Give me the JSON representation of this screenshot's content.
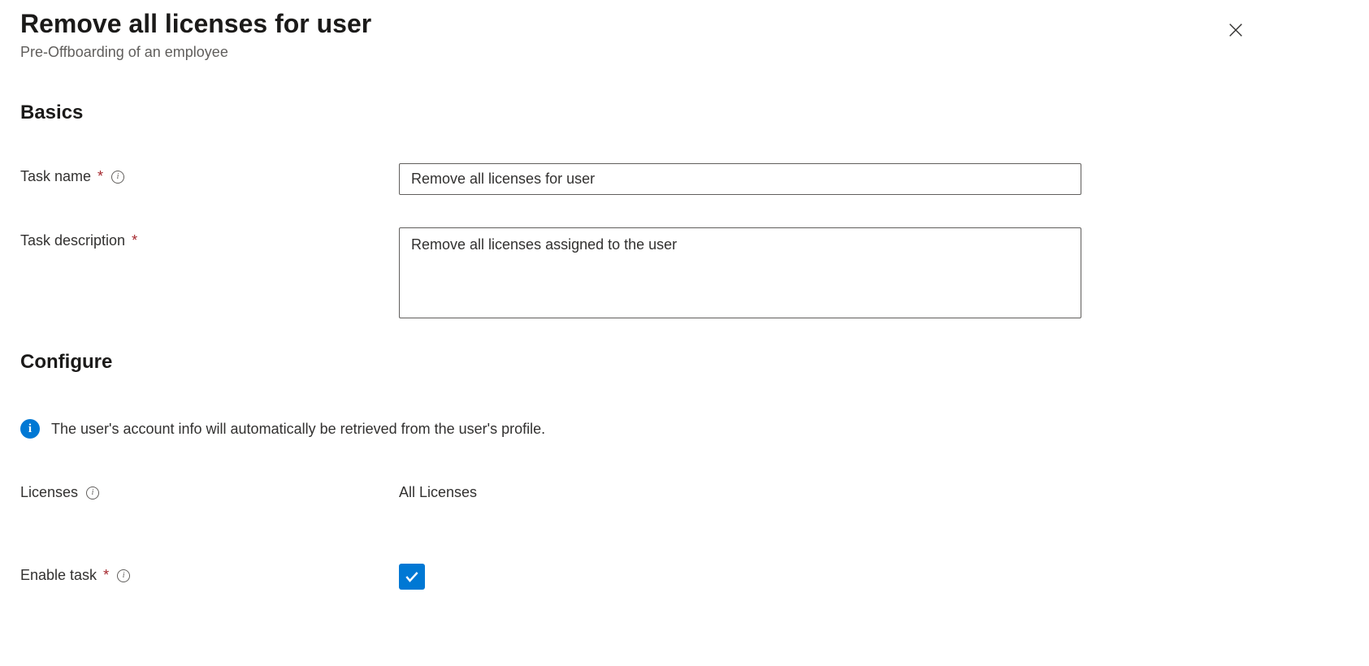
{
  "header": {
    "title": "Remove all licenses for user",
    "subtitle": "Pre-Offboarding of an employee"
  },
  "sections": {
    "basics": "Basics",
    "configure": "Configure"
  },
  "basics": {
    "taskNameLabel": "Task name",
    "taskNameValue": "Remove all licenses for user",
    "taskDescriptionLabel": "Task description",
    "taskDescriptionValue": "Remove all licenses assigned to the user"
  },
  "configure": {
    "infoText": "The user's account info will automatically be retrieved from the user's profile.",
    "licensesLabel": "Licenses",
    "licensesValue": "All Licenses",
    "enableTaskLabel": "Enable task",
    "enableTaskChecked": true
  }
}
